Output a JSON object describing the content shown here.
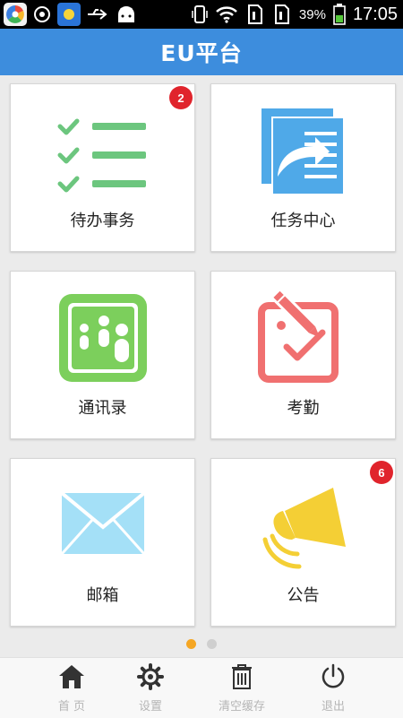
{
  "status_bar": {
    "battery_percent": "39%",
    "time": "17:05"
  },
  "header": {
    "title": "EU平台"
  },
  "tiles": [
    {
      "label": "待办事务",
      "badge": "2"
    },
    {
      "label": "任务中心"
    },
    {
      "label": "通讯录"
    },
    {
      "label": "考勤"
    },
    {
      "label": "邮箱"
    },
    {
      "label": "公告",
      "badge": "6"
    }
  ],
  "pager": {
    "active_index": 0,
    "count": 2,
    "active_color": "#f5a623",
    "inactive_color": "#cfcfcf"
  },
  "bottom_nav": [
    {
      "label": "首 页",
      "icon": "home-icon"
    },
    {
      "label": "设置",
      "icon": "gear-icon"
    },
    {
      "label": "清空缓存",
      "icon": "trash-icon"
    },
    {
      "label": "退出",
      "icon": "power-icon"
    }
  ],
  "colors": {
    "header": "#3d8ddd",
    "badge": "#e0242c",
    "todo_green": "#6cc67e",
    "task_blue": "#4fa9e8",
    "contacts_green": "#7ccf5c",
    "attendance_red": "#f07070",
    "mail_blue": "#a4e0f7",
    "notice_yellow": "#f4cf35"
  }
}
